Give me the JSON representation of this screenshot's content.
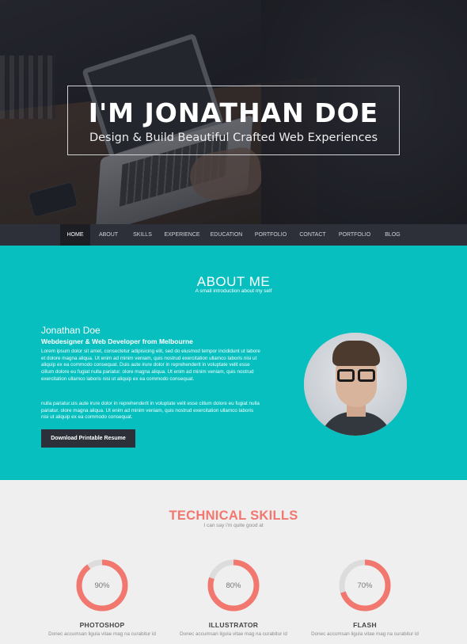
{
  "hero": {
    "title": "I'M JONATHAN DOE",
    "subtitle": "Design & Build Beautiful Crafted Web Experiences"
  },
  "nav": {
    "items": [
      "HOME",
      "ABOUT",
      "SKILLS",
      "EXPERIENCE",
      "EDUCATION",
      "PORTFOLIO",
      "CONTACT",
      "PORTFOLIO",
      "BLOG"
    ],
    "active": "HOME"
  },
  "about": {
    "title": "ABOUT ME",
    "subtitle": "A small introduction about my self",
    "name": "Jonathan Doe",
    "role": "Webdesigner & Web Developer from Melbourne",
    "paragraph1": "Lorem ipsum dolor sit amet, consectetur adipisicing elit, sed do eiusmod tempor incididunt ut labore et dolore magna aliqua. Ut enim ad minim veniam, quis nostrud exercitation ullamco laboris nisi ut aliquip ex ea commodo consequat. Duis aute irure dolor in reprehenderit in voluptate velit esse cillum dolore eu fugiat nulla pariatur. olore magna aliqua. Ut enim ad minim veniam, quis nostrud exercitation ullamco laboris nisi ut aliquip ex ea commodo consequat.",
    "paragraph2": "nulla pariatur.uis aute irure dolor in reprehenderit in voluptate velit esse cillum dolore eu fugiat nulla pariatur. olore magna aliqua. Ut enim ad minim veniam, quis nostrud exercitation ullamco laboris nisi ut aliquip ex ea commodo consequat.",
    "resume_button": "Download Printable Resume"
  },
  "skills": {
    "title": "TECHNICAL SKILLS",
    "subtitle": "I can say i'm quite good at",
    "items": [
      {
        "name": "PHOTOSHOP",
        "percent": 90,
        "label": "90%",
        "desc": "Donec accumsan ligula vitae mag na curabitur id"
      },
      {
        "name": "ILLUSTRATOR",
        "percent": 80,
        "label": "80%",
        "desc": "Donec accumsan ligula vitae mag na curabitur id"
      },
      {
        "name": "FLASH",
        "percent": 70,
        "label": "70%",
        "desc": "Donec accumsan ligula vitae mag na curabitur id"
      }
    ]
  },
  "colors": {
    "teal": "#08bfbf",
    "dark": "#2d3038",
    "accent": "#f2776e",
    "track": "#dcdcdc"
  }
}
